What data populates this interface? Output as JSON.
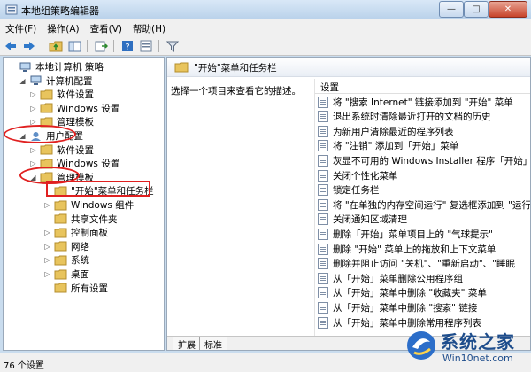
{
  "window": {
    "title": "本地组策略编辑器",
    "minimize": "—",
    "maximize": "□",
    "close": "✕"
  },
  "menu": [
    "文件(F)",
    "操作(A)",
    "查看(V)",
    "帮助(H)"
  ],
  "toolbar": {
    "icons": [
      "back-arrow-icon",
      "forward-arrow-icon",
      "folder-up-icon",
      "show-hide-tree-icon",
      "export-list-icon",
      "help-icon",
      "properties-icon",
      "filter-icon"
    ]
  },
  "tree": [
    {
      "label": "本地计算机 策略",
      "level": 0,
      "expander": "",
      "icon": "computer-policy-icon"
    },
    {
      "label": "计算机配置",
      "level": 1,
      "expander": "◢",
      "icon": "computer-icon"
    },
    {
      "label": "软件设置",
      "level": 2,
      "expander": "▷",
      "icon": "folder-icon"
    },
    {
      "label": "Windows 设置",
      "level": 2,
      "expander": "▷",
      "icon": "folder-icon"
    },
    {
      "label": "管理模板",
      "level": 2,
      "expander": "▷",
      "icon": "folder-icon"
    },
    {
      "label": "用户配置",
      "level": 1,
      "expander": "◢",
      "icon": "user-icon"
    },
    {
      "label": "软件设置",
      "level": 2,
      "expander": "▷",
      "icon": "folder-icon"
    },
    {
      "label": "Windows 设置",
      "level": 2,
      "expander": "▷",
      "icon": "folder-icon"
    },
    {
      "label": "管理模板",
      "level": 2,
      "expander": "◢",
      "icon": "folder-icon"
    },
    {
      "label": "\"开始\"菜单和任务栏",
      "level": 3,
      "expander": "",
      "icon": "folder-icon"
    },
    {
      "label": "Windows 组件",
      "level": 3,
      "expander": "▷",
      "icon": "folder-icon"
    },
    {
      "label": "共享文件夹",
      "level": 3,
      "expander": "",
      "icon": "folder-icon"
    },
    {
      "label": "控制面板",
      "level": 3,
      "expander": "▷",
      "icon": "folder-icon"
    },
    {
      "label": "网络",
      "level": 3,
      "expander": "▷",
      "icon": "folder-icon"
    },
    {
      "label": "系统",
      "level": 3,
      "expander": "▷",
      "icon": "folder-icon"
    },
    {
      "label": "桌面",
      "level": 3,
      "expander": "▷",
      "icon": "folder-icon"
    },
    {
      "label": "所有设置",
      "level": 3,
      "expander": "",
      "icon": "folder-icon"
    }
  ],
  "right": {
    "header": "\"开始\"菜单和任务栏",
    "description": "选择一个项目来查看它的描述。",
    "column": "设置",
    "settings": [
      "将 \"搜索 Internet\" 链接添加到 \"开始\" 菜单",
      "退出系统时清除最近打开的文档的历史",
      "为新用户清除最近的程序列表",
      "将 \"注销\" 添加到「开始」菜单",
      "灰显不可用的 Windows Installer 程序「开始」菜",
      "关闭个性化菜单",
      "锁定任务栏",
      "将 \"在单独的内存空间运行\" 复选框添加到 \"运行",
      "关闭通知区域清理",
      "删除「开始」菜单项目上的 \"气球提示\"",
      "删除 \"开始\" 菜单上的拖放和上下文菜单",
      "删除并阻止访问 \"关机\"、\"重新启动\"、\"睡眠",
      "从「开始」菜单删除公用程序组",
      "从「开始」菜单中删除 \"收藏夹\" 菜单",
      "从「开始」菜单中删除 \"搜索\" 链接",
      "从「开始」菜单中删除常用程序列表"
    ],
    "tabs": [
      "扩展",
      "标准"
    ]
  },
  "status": "76 个设置",
  "watermark": {
    "brand": "系统之家",
    "url": "Win10net.com"
  },
  "colors": {
    "highlight": "#e02020",
    "brand": "#1e4d8c"
  }
}
